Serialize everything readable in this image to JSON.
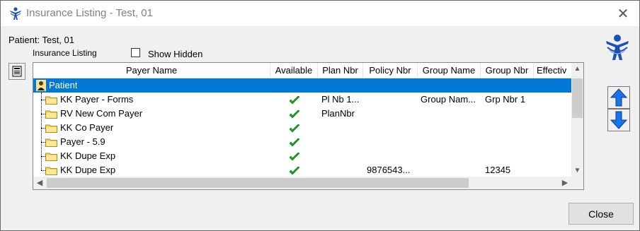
{
  "window": {
    "title": "Insurance Listing - Test, 01",
    "icon": "person-logo-icon"
  },
  "patient_line": "Patient:  Test, 01",
  "insurance_listing_label": "Insurance Listing",
  "show_hidden": {
    "label": "Show Hidden",
    "checked": false
  },
  "grid": {
    "columns": [
      "Payer Name",
      "Available",
      "Plan Nbr",
      "Policy Nbr",
      "Group Name",
      "Group Nbr",
      "Effectiv"
    ],
    "root": {
      "label": "Patient",
      "icon": "patient-icon",
      "selected": true
    },
    "rows": [
      {
        "payer": "KK Payer - Forms",
        "available": true,
        "plan": "Pl Nb 1...",
        "policy": "",
        "group_name": "Group Nam...",
        "group_nbr": "Grp Nbr 1",
        "effective": ""
      },
      {
        "payer": "RV New Com Payer",
        "available": true,
        "plan": "PlanNbr",
        "policy": "",
        "group_name": "",
        "group_nbr": "",
        "effective": ""
      },
      {
        "payer": "KK Co Payer",
        "available": true,
        "plan": "",
        "policy": "",
        "group_name": "",
        "group_nbr": "",
        "effective": ""
      },
      {
        "payer": "Payer - 5.9",
        "available": true,
        "plan": "",
        "policy": "",
        "group_name": "",
        "group_nbr": "",
        "effective": ""
      },
      {
        "payer": "KK Dupe Exp",
        "available": true,
        "plan": "",
        "policy": "",
        "group_name": "",
        "group_nbr": "",
        "effective": ""
      },
      {
        "payer": "KK Dupe Exp",
        "available": true,
        "plan": "",
        "policy": "9876543...",
        "group_name": "",
        "group_nbr": "12345",
        "effective": ""
      }
    ]
  },
  "buttons": {
    "close": "Close",
    "move_up_icon": "arrow-up-icon",
    "move_down_icon": "arrow-down-icon"
  },
  "colors": {
    "selection": "#0078d7",
    "check": "#1aaa1a",
    "arrow": "#1a73e8"
  }
}
